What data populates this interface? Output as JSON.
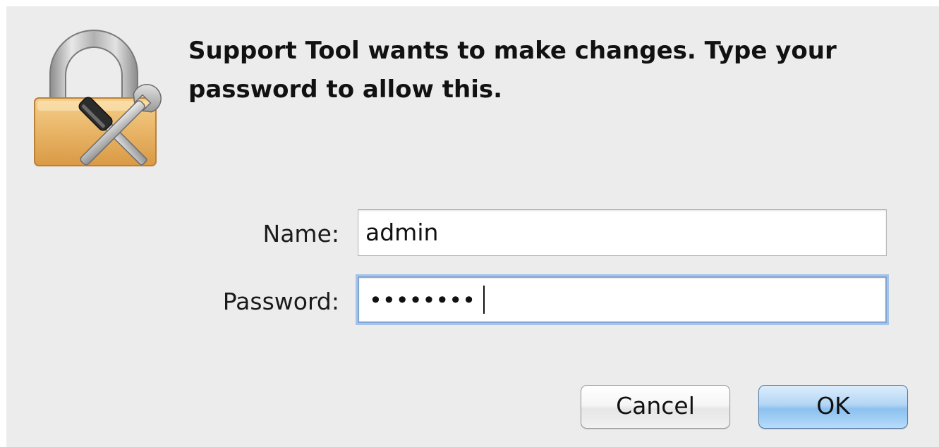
{
  "dialog": {
    "message": "Support Tool wants to make changes. Type your password to allow this.",
    "icon": "lock-with-tools-icon"
  },
  "form": {
    "name_label": "Name:",
    "name_value": "admin",
    "password_label": "Password:",
    "password_masked": "••••••••"
  },
  "buttons": {
    "cancel_label": "Cancel",
    "ok_label": "OK"
  },
  "colors": {
    "dialog_background": "#ececec",
    "focus_ring": "#a7c4e8",
    "default_button": "#8cc0ef",
    "lock_body": "#e8b466"
  }
}
